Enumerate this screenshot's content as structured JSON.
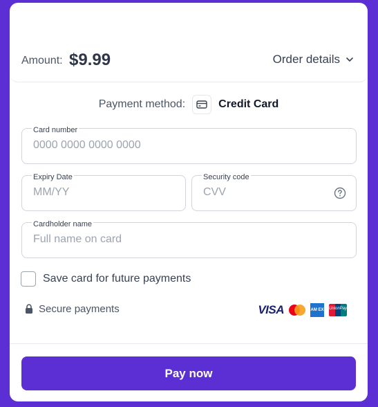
{
  "amount": {
    "label": "Amount:",
    "value": "$9.99"
  },
  "order_details": {
    "label": "Order details"
  },
  "payment_method": {
    "label": "Payment method:",
    "value": "Credit Card",
    "icon": "credit-card-icon"
  },
  "fields": {
    "card_number": {
      "label": "Card number",
      "placeholder": "0000 0000 0000 0000",
      "value": ""
    },
    "expiry": {
      "label": "Expiry Date",
      "placeholder": "MM/YY",
      "value": ""
    },
    "security": {
      "label": "Security code",
      "placeholder": "CVV",
      "value": "",
      "icon": "help-circle-icon"
    },
    "cardholder": {
      "label": "Cardholder name",
      "placeholder": "Full name on card",
      "value": ""
    }
  },
  "save_card": {
    "label": "Save card for future payments",
    "checked": false
  },
  "secure": {
    "label": "Secure payments",
    "icon": "lock-icon"
  },
  "card_logos": {
    "visa": "VISA",
    "amex": "AM EX",
    "unionpay": "UnionPay",
    "brands": [
      "visa-logo",
      "mastercard-logo",
      "amex-logo",
      "unionpay-logo"
    ]
  },
  "pay_button": {
    "label": "Pay now"
  },
  "colors": {
    "accent": "#5b2fd3",
    "background": "#5b2fd3",
    "card": "#ffffff"
  }
}
